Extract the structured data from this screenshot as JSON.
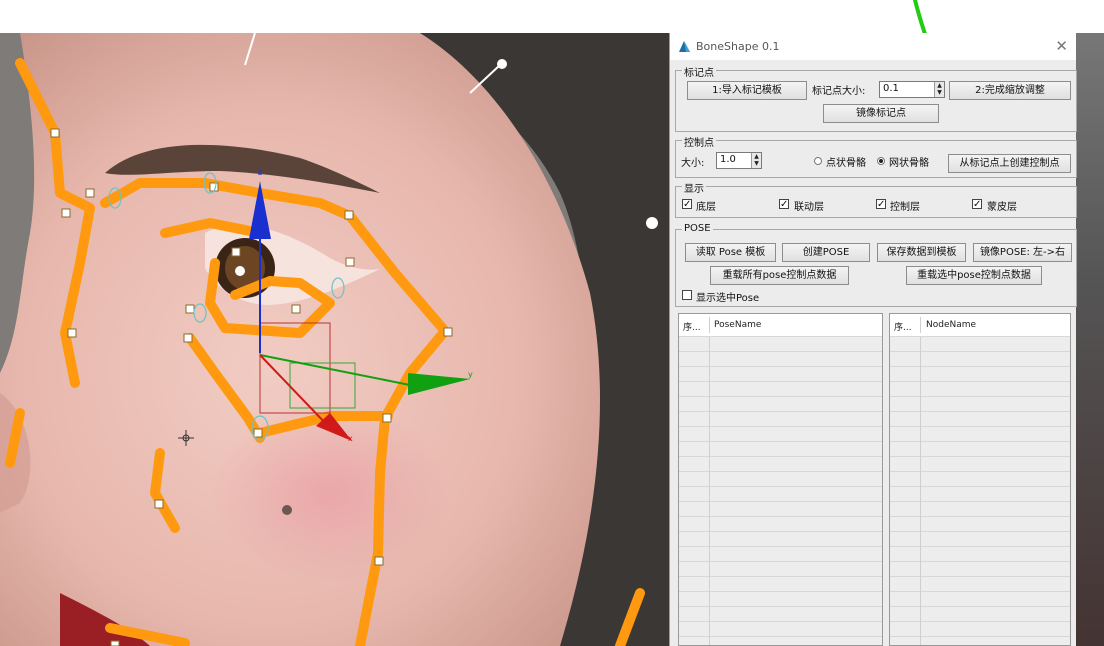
{
  "window": {
    "title": "BoneShape 0.1",
    "close_label": "✕"
  },
  "marker_group": {
    "label": "标记点",
    "import_button": "1:导入标记模板",
    "size_label": "标记点大小:",
    "size_value": "0.1",
    "finish_button": "2:完成缩放调整",
    "mirror_button": "镜像标记点"
  },
  "control_group": {
    "label": "控制点",
    "size_label": "大小:",
    "size_value": "1.0",
    "radio_point": "点状骨骼",
    "radio_mesh": "网状骨骼",
    "selected_radio": "网状骨骼",
    "create_button": "从标记点上创建控制点"
  },
  "display_group": {
    "label": "显示",
    "layers": [
      {
        "label": "底层",
        "checked": true
      },
      {
        "label": "联动层",
        "checked": true
      },
      {
        "label": "控制层",
        "checked": true
      },
      {
        "label": "蒙皮层",
        "checked": true
      }
    ]
  },
  "pose_group": {
    "label": "POSE",
    "read_template_button": "读取 Pose 模板",
    "create_pose_button": "创建POSE",
    "save_to_template_button": "保存数据到模板",
    "mirror_pose_button": "镜像POSE: 左->右",
    "reload_all_button": "重载所有pose控制点数据",
    "reload_selected_button": "重载选中pose控制点数据",
    "show_selected_label": "显示选中Pose",
    "show_selected_checked": false
  },
  "pose_list": {
    "col_index": "序...",
    "col_name": "PoseName"
  },
  "node_list": {
    "col_index": "序...",
    "col_name": "NodeName"
  },
  "colors": {
    "bone_orange": "#ff9a10",
    "annotation_arrow": "#22cc11",
    "gizmo_z": "#1a2fd0",
    "gizmo_y": "#11a011",
    "gizmo_x": "#d01a1a"
  },
  "icons": [
    "app-logo-icon",
    "close-icon",
    "spinner-arrows-icon",
    "annotation-arrow-icon",
    "transform-gizmo-icon"
  ],
  "viewport": {
    "gizmo_labels": {
      "y": "y",
      "z": "z",
      "x": "x"
    }
  }
}
